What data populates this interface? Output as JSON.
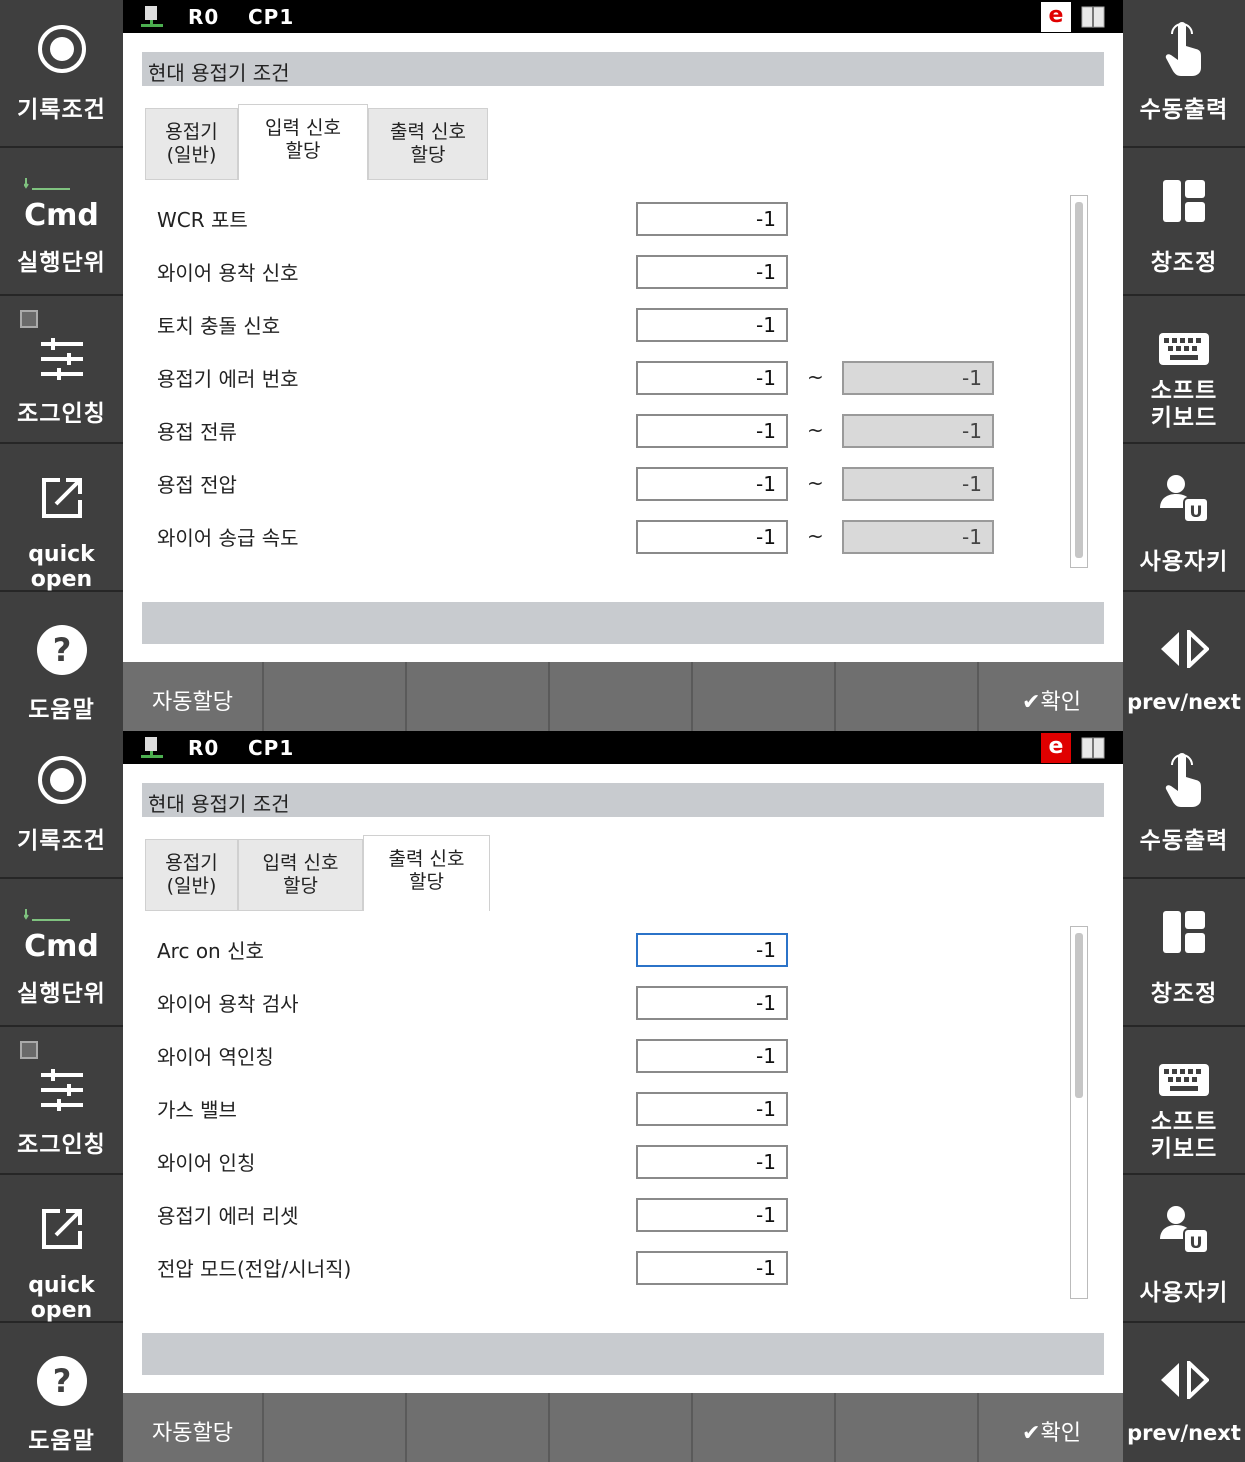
{
  "left_menu": {
    "record_condition": "기록조건",
    "cmd": "Cmd",
    "exec_unit": "실행단위",
    "jog_inching": "조그인칭",
    "quick_open": "quick open",
    "help": "도움말"
  },
  "right_menu": {
    "manual_output": "수동출력",
    "ref_point": "창조정",
    "soft_keyboard_1": "소프트",
    "soft_keyboard_2": "키보드",
    "user_key": "사용자키",
    "prev_next": "prev/next"
  },
  "status": {
    "robot": "R0",
    "program": "CP1",
    "e_badge": "e",
    "e_badge_color_top": "#ffffff",
    "e_badge_text_top": "#e00000",
    "e_badge_color_bottom": "#e00000",
    "e_badge_text_bottom": "#ffffff"
  },
  "dialog_title": "현대 용접기 조건",
  "tabs": {
    "general_1": "용접기",
    "general_2": "(일반)",
    "input_1": "입력 신호",
    "input_2": "할당",
    "output_1": "출력 신호",
    "output_2": "할당"
  },
  "input_rows": [
    {
      "label": "WCR 포트",
      "value": "-1"
    },
    {
      "label": "와이어 용착 신호",
      "value": "-1"
    },
    {
      "label": "토치 충돌 신호",
      "value": "-1"
    },
    {
      "label": "용접기 에러 번호",
      "value": "-1",
      "value2": "-1"
    },
    {
      "label": "용접 전류",
      "value": "-1",
      "value2": "-1"
    },
    {
      "label": "용접 전압",
      "value": "-1",
      "value2": "-1"
    },
    {
      "label": "와이어 송급 속도",
      "value": "-1",
      "value2": "-1"
    }
  ],
  "output_rows": [
    {
      "label": "Arc on 신호",
      "value": "-1"
    },
    {
      "label": "와이어 용착 검사",
      "value": "-1"
    },
    {
      "label": "와이어 역인칭",
      "value": "-1"
    },
    {
      "label": "가스 밸브",
      "value": "-1"
    },
    {
      "label": "와이어 인칭",
      "value": "-1"
    },
    {
      "label": "용접기 에러 리셋",
      "value": "-1"
    },
    {
      "label": "전압 모드(전압/시너직)",
      "value": "-1"
    }
  ],
  "range_sep": "~",
  "bottom": {
    "auto_assign": "자동할당",
    "confirm": "✔확인"
  }
}
